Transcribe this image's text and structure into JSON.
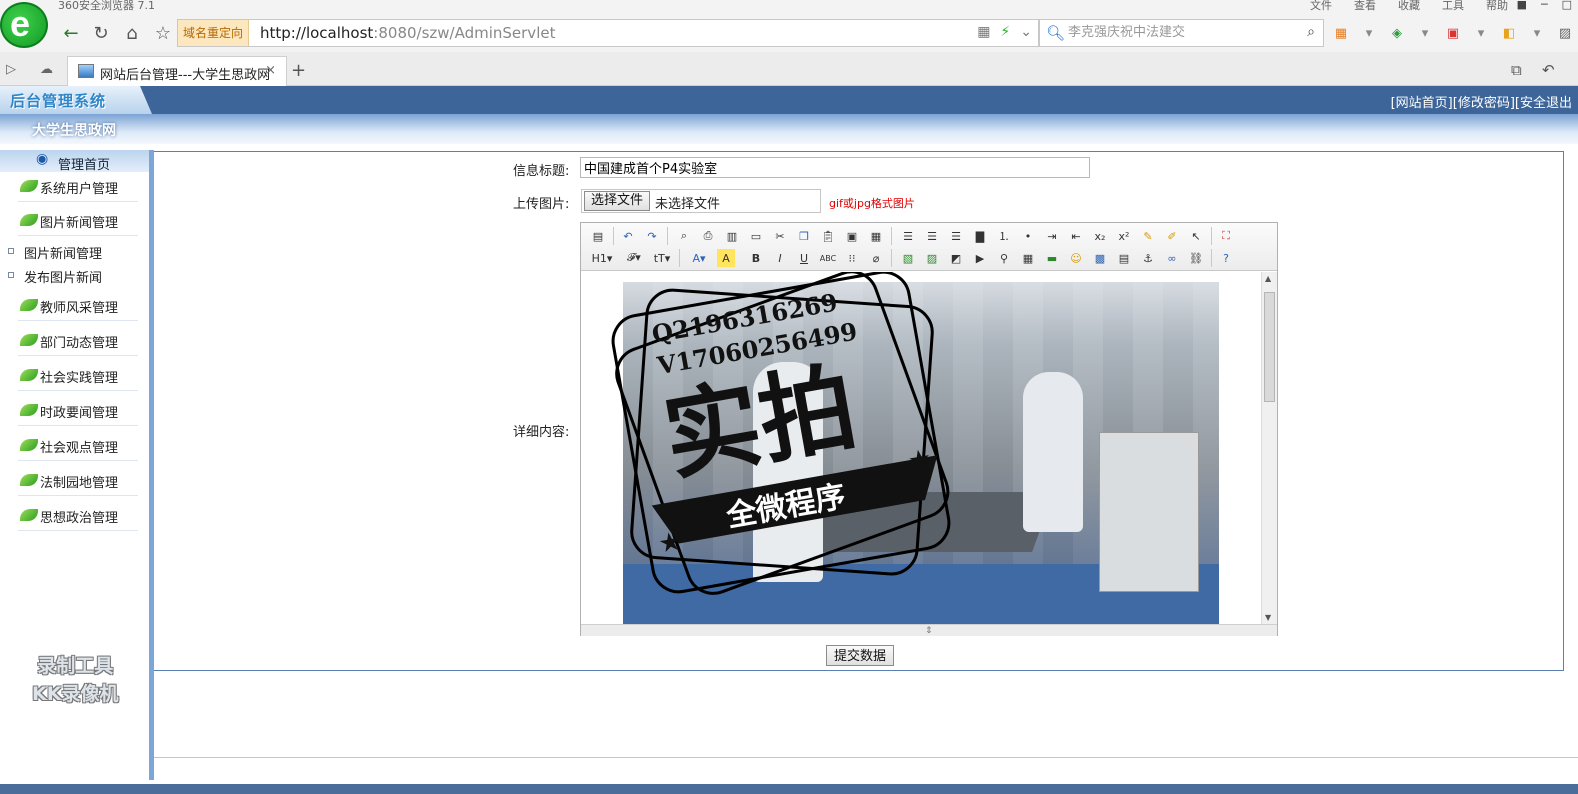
{
  "browser": {
    "window_title": "360安全浏览器 7.1",
    "menus": [
      "文件",
      "查看",
      "收藏",
      "工具",
      "帮助"
    ],
    "redirect_tag": "域名重定向",
    "url_host": "http://localhost",
    "url_rest": ":8080/szw/AdminServlet",
    "search_placeholder": "李克强庆祝中法建交",
    "tab_title": "网站后台管理---大学生思政网"
  },
  "header": {
    "logo": "后台管理系统",
    "links": [
      "[网站首页]",
      "[修改密码]",
      "[安全退出"
    ],
    "site_name": "大学生思政网"
  },
  "sidebar": {
    "home": "管理首页",
    "items": [
      {
        "label": "系统用户管理"
      },
      {
        "label": "图片新闻管理"
      },
      {
        "label": "教师风采管理"
      },
      {
        "label": "部门动态管理"
      },
      {
        "label": "社会实践管理"
      },
      {
        "label": "时政要闻管理"
      },
      {
        "label": "社会观点管理"
      },
      {
        "label": "法制园地管理"
      },
      {
        "label": "思想政治管理"
      }
    ],
    "subitems": [
      "图片新闻管理",
      "发布图片新闻"
    ]
  },
  "form": {
    "title_label": "信息标题:",
    "title_value": "中国建成首个P4实验室",
    "upload_label": "上传图片:",
    "choose_file": "选择文件",
    "no_file": "未选择文件",
    "file_hint": "gif或jpg格式图片",
    "content_label": "详细内容:",
    "submit": "提交数据"
  },
  "stamp": {
    "qq": "Q2196316269",
    "vx": "V17060256499",
    "big": "实拍",
    "banner": "全微程序"
  },
  "watermark": {
    "line1": "录制工具",
    "line2": "KK录像机"
  }
}
